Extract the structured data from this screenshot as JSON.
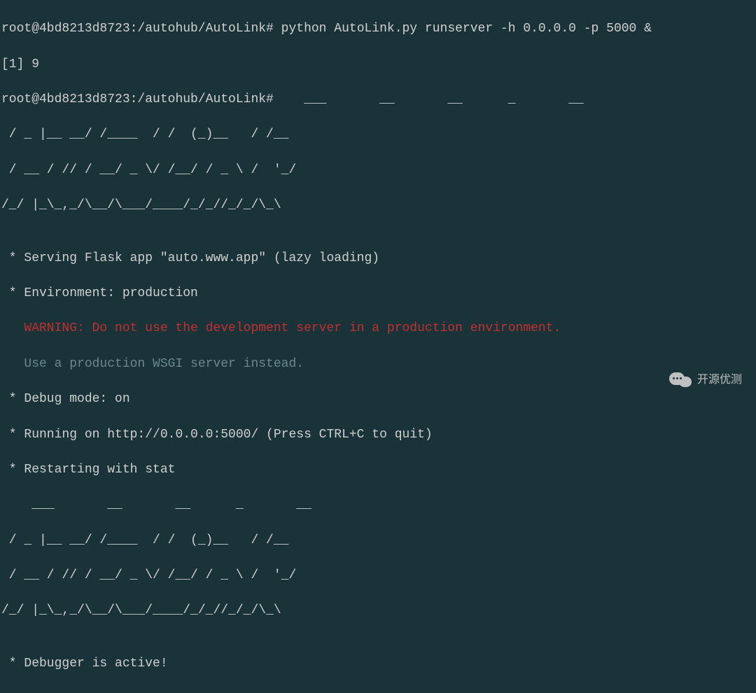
{
  "terminal": {
    "line1_prompt": "root@4bd8213d8723:/autohub/AutoLink#",
    "line1_cmd": " python AutoLink.py runserver -h 0.0.0.0 -p 5000 &",
    "line2": "[1] 9",
    "line3_prompt": "root@4bd8213d8723:/autohub/AutoLink#",
    "ascii1": "    ___       __       __      _       __",
    "ascii2": " / _ |__ __/ /____  / /  (_)__   / /__",
    "ascii3": " / __ / // / __/ _ \\/ /__/ / _ \\ /  '_/",
    "ascii4": "/_/ |_\\_,_/\\__/\\___/____/_/_//_/_/\\_\\",
    "blank1": "",
    "serving": " * Serving Flask app \"auto.www.app\" (lazy loading)",
    "env": " * Environment: production",
    "warning": "   WARNING: Do not use the development server in a production environment.",
    "wsgi": "   Use a production WSGI server instead.",
    "debug": " * Debug mode: on",
    "running": " * Running on http://0.0.0.0:5000/ (Press CTRL+C to quit)",
    "restart": " * Restarting with stat",
    "ascii5": "    ___       __       __      _       __",
    "ascii6": " / _ |__ __/ /____  / /  (_)__   / /__",
    "ascii7": " / __ / // / __/ _ \\/ /__/ / _ \\ /  '_/",
    "ascii8": "/_/ |_\\_,_/\\__/\\___/____/_/_//_/_/\\_\\",
    "blank2": "",
    "debugger": " * Debugger is active!"
  },
  "watermark": {
    "text": "开源优测"
  },
  "colors": {
    "bg": "#1a3339",
    "text": "#d0d0d0",
    "warning": "#c03030",
    "dim": "#6a8a8a"
  }
}
